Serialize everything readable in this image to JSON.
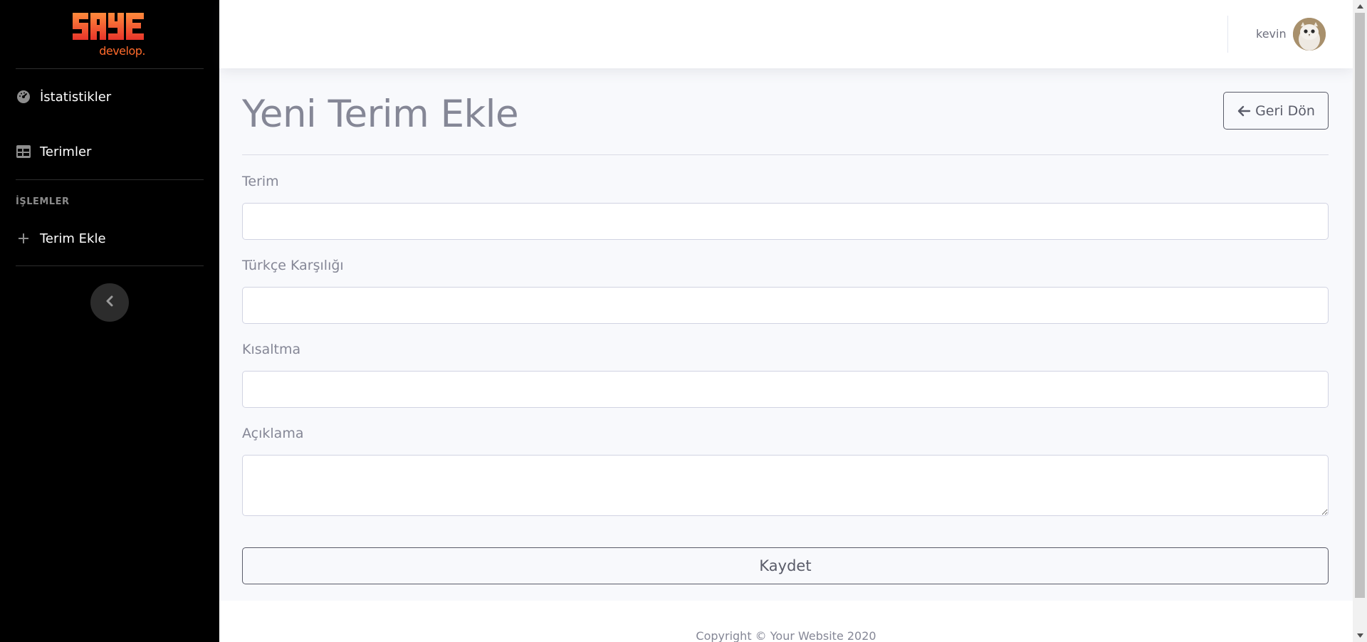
{
  "sidebar": {
    "logo": {
      "wordmark": "SAYE",
      "sub": "develop",
      "dot": "."
    },
    "items": [
      {
        "label": "İstatistikler",
        "icon": "dashboard-gauge-icon"
      },
      {
        "label": "Terimler",
        "icon": "table-icon"
      }
    ],
    "section_heading": "İŞLEMLER",
    "actions": [
      {
        "label": "Terim Ekle",
        "icon": "plus-icon"
      }
    ],
    "collapse_icon": "chevron-left-icon"
  },
  "topbar": {
    "user_name": "kevin",
    "avatar": "user-avatar-owl"
  },
  "page": {
    "title": "Yeni Terim Ekle",
    "back_button_label": "Geri Dön",
    "back_icon": "arrow-left-icon"
  },
  "form": {
    "fields": [
      {
        "label": "Terim",
        "value": "",
        "placeholder": ""
      },
      {
        "label": "Türkçe Karşılığı",
        "value": "",
        "placeholder": ""
      },
      {
        "label": "Kısaltma",
        "value": "",
        "placeholder": ""
      },
      {
        "label": "Açıklama",
        "value": "",
        "placeholder": ""
      }
    ],
    "submit_label": "Kaydet"
  },
  "footer": {
    "copyright": "Copyright © Your Website 2020"
  },
  "colors": {
    "sidebar_bg": "#000000",
    "logo_orange": "#ff6a2b",
    "text_muted": "#858796",
    "content_bg": "#f8f9fc"
  }
}
